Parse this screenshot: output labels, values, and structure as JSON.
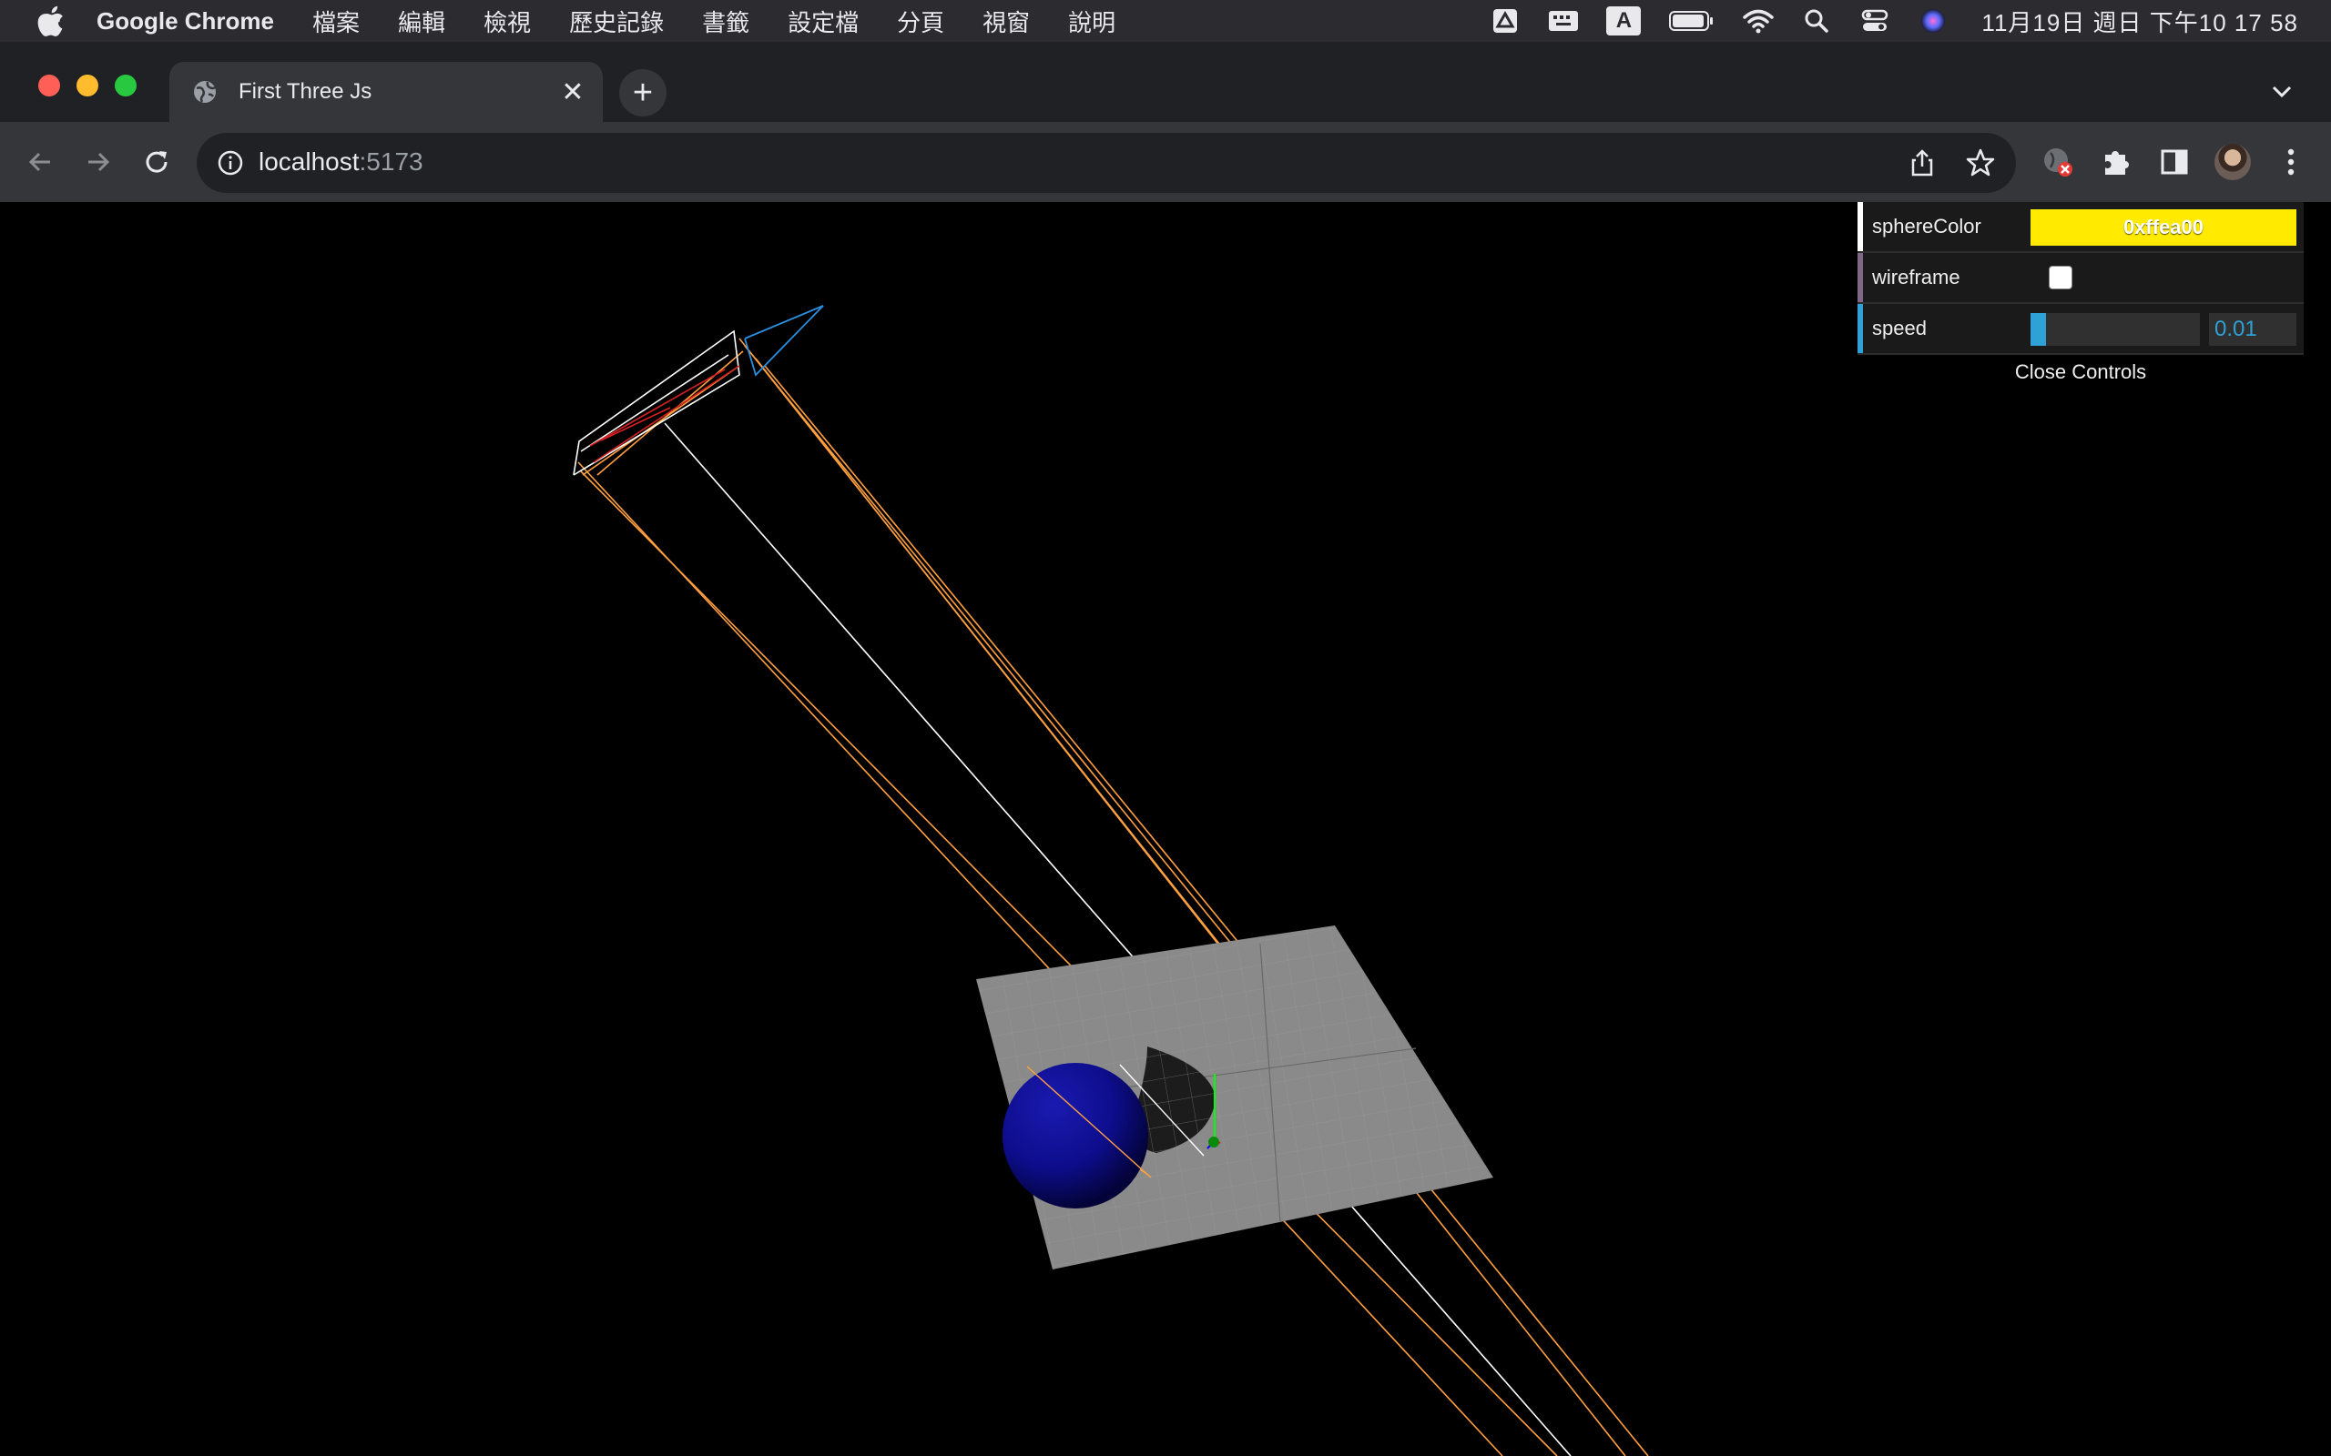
{
  "menubar": {
    "app_name": "Google Chrome",
    "items": [
      "檔案",
      "編輯",
      "檢視",
      "歷史記錄",
      "書籤",
      "設定檔",
      "分頁",
      "視窗",
      "說明"
    ],
    "input_indicator": "A",
    "clock": "11月19日 週日 下午10 17 58"
  },
  "browser": {
    "tab_title": "First Three Js",
    "tab_close": "✕",
    "new_tab": "+",
    "url_host": "localhost",
    "url_port": ":5173"
  },
  "gui": {
    "controls": [
      {
        "label": "sphereColor",
        "value": "0xffea00",
        "color": "#ffea00"
      },
      {
        "label": "wireframe",
        "checked": false
      },
      {
        "label": "speed",
        "value": "0.01",
        "fraction": 0.01
      }
    ],
    "close_label": "Close Controls"
  },
  "scene": {
    "sphere_color": "#0d0d8c",
    "plane_color": "#8a8a8a",
    "camera_helper_color": "#ffa040",
    "spotlight_line_color": "#ffffff",
    "axes_colors": [
      "#00ff00",
      "#0000ff",
      "#ff0000"
    ]
  }
}
